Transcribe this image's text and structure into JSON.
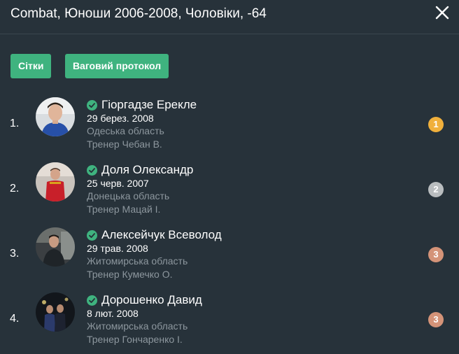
{
  "header": {
    "title": "Combat, Юноши 2006-2008, Чоловіки, -64",
    "close_icon": "close-icon"
  },
  "actions": {
    "grids_label": "Сітки",
    "weigh_label": "Ваговий протокол"
  },
  "colors": {
    "accent": "#3fb37f",
    "background": "#27323a",
    "gold": "#f0b03c",
    "silver": "#b9bdbf",
    "bronze": "#d49378"
  },
  "athletes": [
    {
      "rank": "1.",
      "name": "Гіоргадзе Ерекле",
      "dob": "29 берез. 2008",
      "region": "Одеська область",
      "coach": "Тренер Чебан В.",
      "medal": "1",
      "medal_color": "#f0b03c"
    },
    {
      "rank": "2.",
      "name": "Доля Олександр",
      "dob": "25 черв. 2007",
      "region": "Донецька область",
      "coach": "Тренер Мацай І.",
      "medal": "2",
      "medal_color": "#b9bdbf"
    },
    {
      "rank": "3.",
      "name": "Алексейчук Всеволод",
      "dob": "29 трав. 2008",
      "region": "Житомирська область",
      "coach": "Тренер Кумечко О.",
      "medal": "3",
      "medal_color": "#d49378"
    },
    {
      "rank": "4.",
      "name": "Дорошенко Давид",
      "dob": "8 лют. 2008",
      "region": "Житомирська область",
      "coach": "Тренер Гончаренко І.",
      "medal": "3",
      "medal_color": "#d49378"
    }
  ]
}
